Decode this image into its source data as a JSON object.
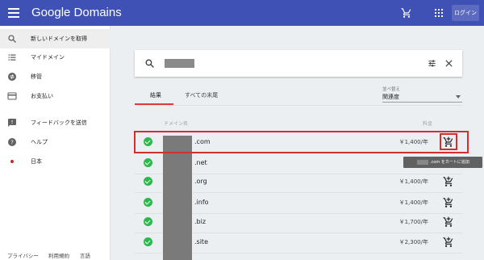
{
  "app": {
    "title": "Google Domains",
    "login_label": "ログイン"
  },
  "sidebar": {
    "items": [
      {
        "label": "新しいドメインを取得",
        "icon": "search-icon"
      },
      {
        "label": "マイドメイン",
        "icon": "list-icon"
      },
      {
        "label": "移管",
        "icon": "transfer-icon"
      },
      {
        "label": "お支払い",
        "icon": "credit-card-icon"
      },
      {
        "label": "フィードバックを送信",
        "icon": "feedback-icon"
      },
      {
        "label": "ヘルプ",
        "icon": "help-icon"
      },
      {
        "label": "日本",
        "icon": "japan-flag-icon"
      }
    ],
    "footer": [
      "プライバシー",
      "利用規約",
      "言語"
    ]
  },
  "tabs": [
    {
      "label": "結果"
    },
    {
      "label": "すべての末尾"
    }
  ],
  "sort": {
    "label": "並べ替え",
    "value": "関連度"
  },
  "table": {
    "header_name": "ドメイン名",
    "header_price": "料金",
    "rows": [
      {
        "tld": ".com",
        "price": "￥1,400/年"
      },
      {
        "tld": ".net",
        "price": "￥1"
      },
      {
        "tld": ".org",
        "price": "￥1,400/年"
      },
      {
        "tld": ".info",
        "price": "￥1,400/年"
      },
      {
        "tld": ".biz",
        "price": "￥1,700/年"
      },
      {
        "tld": ".site",
        "price": "￥2,300/年"
      }
    ]
  },
  "tooltip": {
    "suffix": ".com をカートに追加"
  },
  "colors": {
    "header": "#3f51b5",
    "accent_red": "#d32f2f",
    "check_green": "#2db84d"
  }
}
